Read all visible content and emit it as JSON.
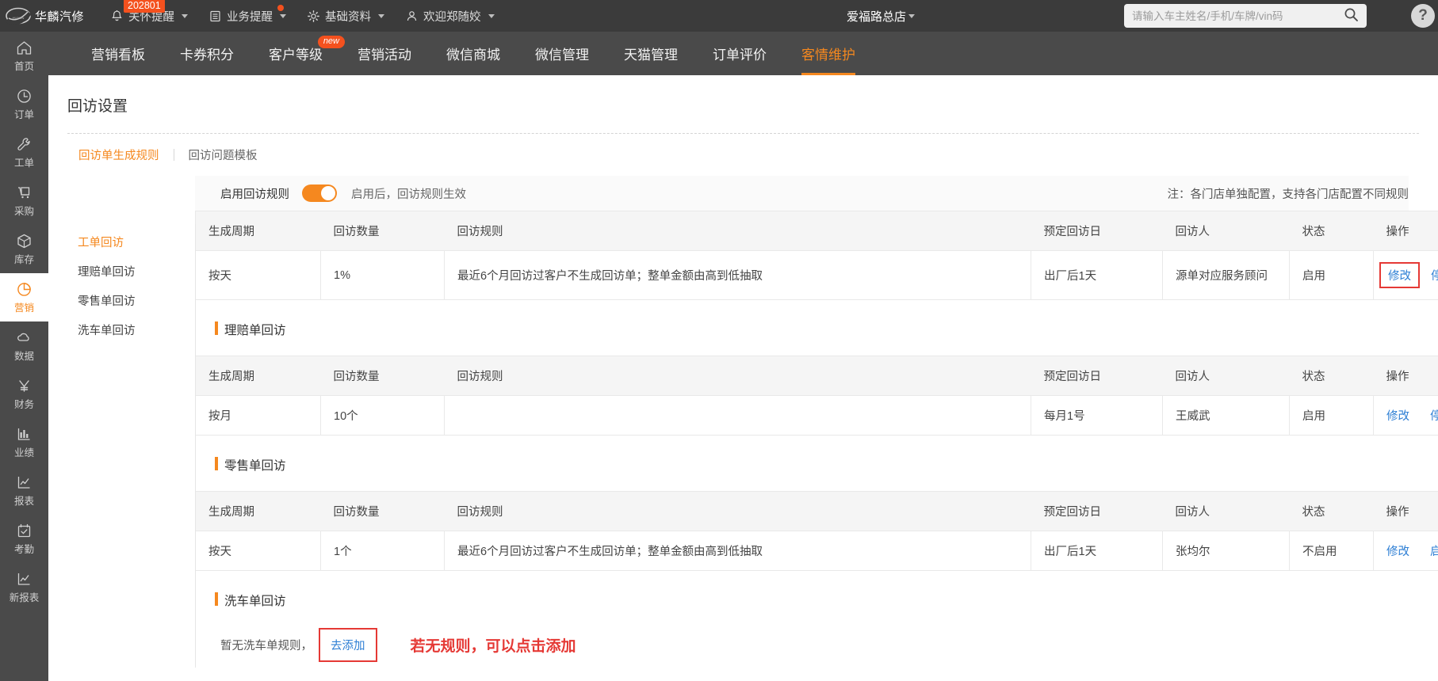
{
  "topbar": {
    "brand": "华麟汽修",
    "nav": [
      {
        "label": "关怀提醒",
        "icon": "bell-icon",
        "badge": "202801",
        "dot": false
      },
      {
        "label": "业务提醒",
        "icon": "list-icon",
        "badge": "",
        "dot": true
      },
      {
        "label": "基础资料",
        "icon": "gear-icon",
        "badge": "",
        "dot": false
      },
      {
        "label": "欢迎郑随姣",
        "icon": "user-icon",
        "badge": "",
        "dot": false
      }
    ],
    "store": "爱福路总店",
    "search_placeholder": "请输入车主姓名/手机/车牌/vin码",
    "search_value": "",
    "help_label": "?"
  },
  "sidebar": {
    "items": [
      {
        "label": "首页",
        "icon": "home-icon",
        "active": false
      },
      {
        "label": "订单",
        "icon": "clock-icon",
        "active": false
      },
      {
        "label": "工单",
        "icon": "wrench-icon",
        "active": false
      },
      {
        "label": "采购",
        "icon": "cart-icon",
        "active": false
      },
      {
        "label": "库存",
        "icon": "box-icon",
        "active": false
      },
      {
        "label": "营销",
        "icon": "pie-icon",
        "active": true
      },
      {
        "label": "数据",
        "icon": "cloud-icon",
        "active": false
      },
      {
        "label": "财务",
        "icon": "yuan-icon",
        "active": false
      },
      {
        "label": "业绩",
        "icon": "bar-chart-icon",
        "active": false
      },
      {
        "label": "报表",
        "icon": "line-chart-icon",
        "active": false
      },
      {
        "label": "考勤",
        "icon": "calendar-check-icon",
        "active": false
      },
      {
        "label": "新报表",
        "icon": "line-chart-icon",
        "active": false
      }
    ]
  },
  "mainnav": {
    "items": [
      {
        "label": "营销看板",
        "active": false,
        "tag": ""
      },
      {
        "label": "卡券积分",
        "active": false,
        "tag": ""
      },
      {
        "label": "客户等级",
        "active": false,
        "tag": "new"
      },
      {
        "label": "营销活动",
        "active": false,
        "tag": ""
      },
      {
        "label": "微信商城",
        "active": false,
        "tag": ""
      },
      {
        "label": "微信管理",
        "active": false,
        "tag": ""
      },
      {
        "label": "天猫管理",
        "active": false,
        "tag": ""
      },
      {
        "label": "订单评价",
        "active": false,
        "tag": ""
      },
      {
        "label": "客情维护",
        "active": true,
        "tag": ""
      }
    ]
  },
  "page": {
    "title": "回访设置",
    "subtabs": [
      {
        "label": "回访单生成规则",
        "active": true
      },
      {
        "label": "回访问题模板",
        "active": false
      }
    ],
    "leftmenu": [
      {
        "label": "工单回访",
        "active": true
      },
      {
        "label": "理赔单回访",
        "active": false
      },
      {
        "label": "零售单回访",
        "active": false
      },
      {
        "label": "洗车单回访",
        "active": false
      }
    ],
    "toggle": {
      "label": "启用回访规则",
      "enabled": true,
      "hint": "启用后，回访规则生效",
      "note": "注：各门店单独配置，支持各门店配置不同规则"
    },
    "columns": [
      "生成周期",
      "回访数量",
      "回访规则",
      "预定回访日",
      "回访人",
      "状态",
      "操作"
    ],
    "sections": [
      {
        "title": "",
        "has_title": false,
        "rows": [
          {
            "cycle": "按天",
            "count": "1%",
            "rule": "最近6个月回访过客户不生成回访单；整单金额由高到低抽取",
            "date": "出厂后1天",
            "person": "源单对应服务顾问",
            "status": "启用",
            "status_on": true,
            "actions": [
              {
                "label": "修改",
                "boxed": true
              },
              {
                "label": "停用",
                "boxed": false
              }
            ]
          }
        ],
        "empty": false
      },
      {
        "title": "理赔单回访",
        "has_title": true,
        "rows": [
          {
            "cycle": "按月",
            "count": "10个",
            "rule": "",
            "date": "每月1号",
            "person": "王威武",
            "status": "启用",
            "status_on": true,
            "actions": [
              {
                "label": "修改",
                "boxed": false
              },
              {
                "label": "停用",
                "boxed": false
              }
            ]
          }
        ],
        "empty": false
      },
      {
        "title": "零售单回访",
        "has_title": true,
        "rows": [
          {
            "cycle": "按天",
            "count": "1个",
            "rule": "最近6个月回访过客户不生成回访单；整单金额由高到低抽取",
            "date": "出厂后1天",
            "person": "张均尔",
            "status": "不启用",
            "status_on": false,
            "actions": [
              {
                "label": "修改",
                "boxed": false
              },
              {
                "label": "启用",
                "boxed": false
              }
            ]
          }
        ],
        "empty": false
      },
      {
        "title": "洗车单回访",
        "has_title": true,
        "rows": [],
        "empty": true,
        "empty_text": "暂无洗车单规则，",
        "empty_link": "去添加",
        "annotation": "若无规则，可以点击添加"
      }
    ]
  },
  "colors": {
    "accent": "#f5881f",
    "link": "#2e7fd4",
    "danger": "#e53935",
    "success": "#52b552",
    "topbar_bg": "#3b3b3b",
    "sidebar_bg": "#4a4a4a"
  }
}
